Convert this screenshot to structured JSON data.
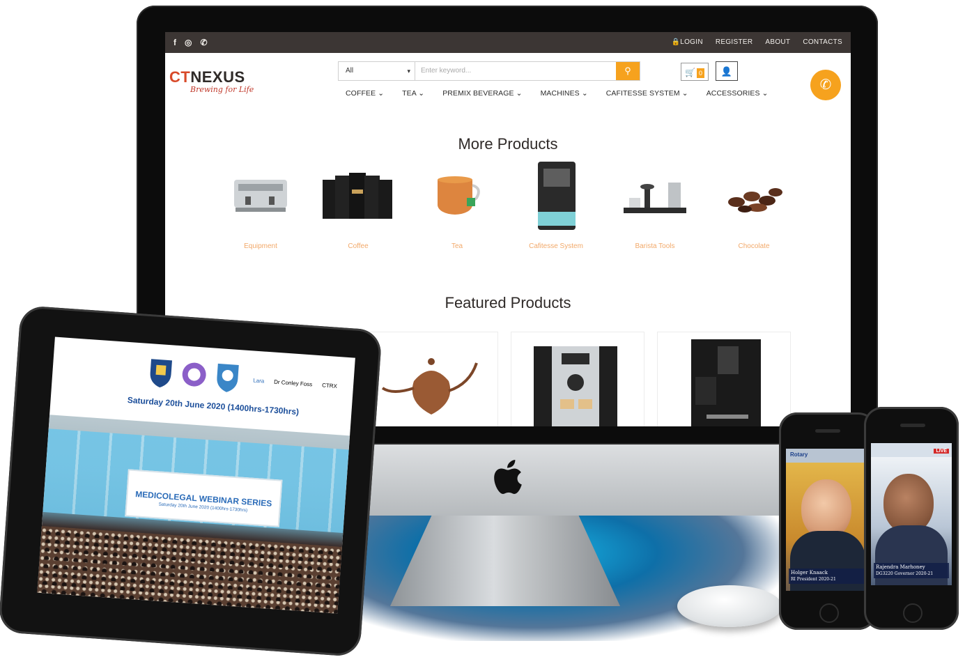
{
  "website": {
    "social_icons": [
      "facebook-icon",
      "instagram-icon",
      "whatsapp-icon"
    ],
    "top_links": {
      "login": "LOGIN",
      "register": "REGISTER",
      "about": "ABOUT",
      "contacts": "CONTACTS"
    },
    "logo": {
      "ct": "CT",
      "nexus": "NEXUS",
      "tagline": "Brewing for Life"
    },
    "search": {
      "category": "All",
      "placeholder": "Enter keyword..."
    },
    "cart_count": "0",
    "nav": [
      "COFFEE",
      "TEA",
      "PREMIX BEVERAGE",
      "MACHINES",
      "CAFITESSE SYSTEM",
      "ACCESSORIES"
    ],
    "more_products_title": "More Products",
    "categories": [
      "Equipment",
      "Coffee",
      "Tea",
      "Cafitesse System",
      "Barista Tools",
      "Chocolate"
    ],
    "featured_title": "Featured Products",
    "accent_color": "#f6a21e"
  },
  "tablet": {
    "links": [
      "Lara",
      "Dr Conley Foss",
      "CTRX"
    ],
    "date_line": "Saturday 20th June 2020 (1400hrs-1730hrs)",
    "banner_title": "MEDICOLEGAL WEBINAR SERIES",
    "banner_sub": "Saturday 20th June 2020 (1400hrs-1730hrs)"
  },
  "phones": [
    {
      "header": "Rotary",
      "name": "Holger Knaack",
      "role": "RI President 2020-21"
    },
    {
      "header": "LIVE",
      "name": "Rajendra Marhoney",
      "role": "DG3220 Governor 2020-21"
    }
  ]
}
